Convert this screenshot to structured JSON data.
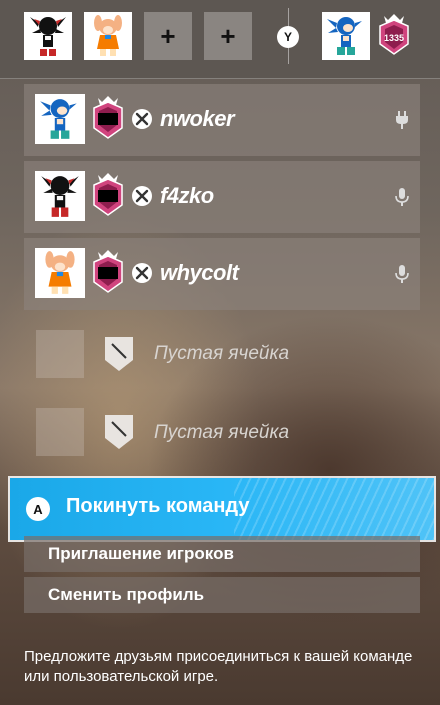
{
  "party_bar": {
    "members": [
      {
        "name": "shadow-avatar"
      },
      {
        "name": "cream-avatar"
      }
    ],
    "empty_slots": [
      "+",
      "+"
    ],
    "y_button": "Y",
    "self": {
      "rank_value": "1335"
    }
  },
  "players": [
    {
      "gamertag": "nwoker",
      "status_icon": "plug-icon"
    },
    {
      "gamertag": "f4zko",
      "status_icon": "microphone-icon"
    },
    {
      "gamertag": "whycolt",
      "status_icon": "microphone-icon"
    }
  ],
  "empty_slots": [
    {
      "label": "Пустая ячейка"
    },
    {
      "label": "Пустая ячейка"
    }
  ],
  "actions": {
    "leave_button_key": "A",
    "leave_label": "Покинуть команду",
    "invite_label": "Приглашение игроков",
    "switch_profile_label": "Сменить профиль"
  },
  "footer": {
    "hint": "Предложите друзьям присоединиться к вашей команде или пользовательской игре."
  },
  "colors": {
    "accent": "#29b6f6",
    "rank_pink": "#d0447e"
  }
}
